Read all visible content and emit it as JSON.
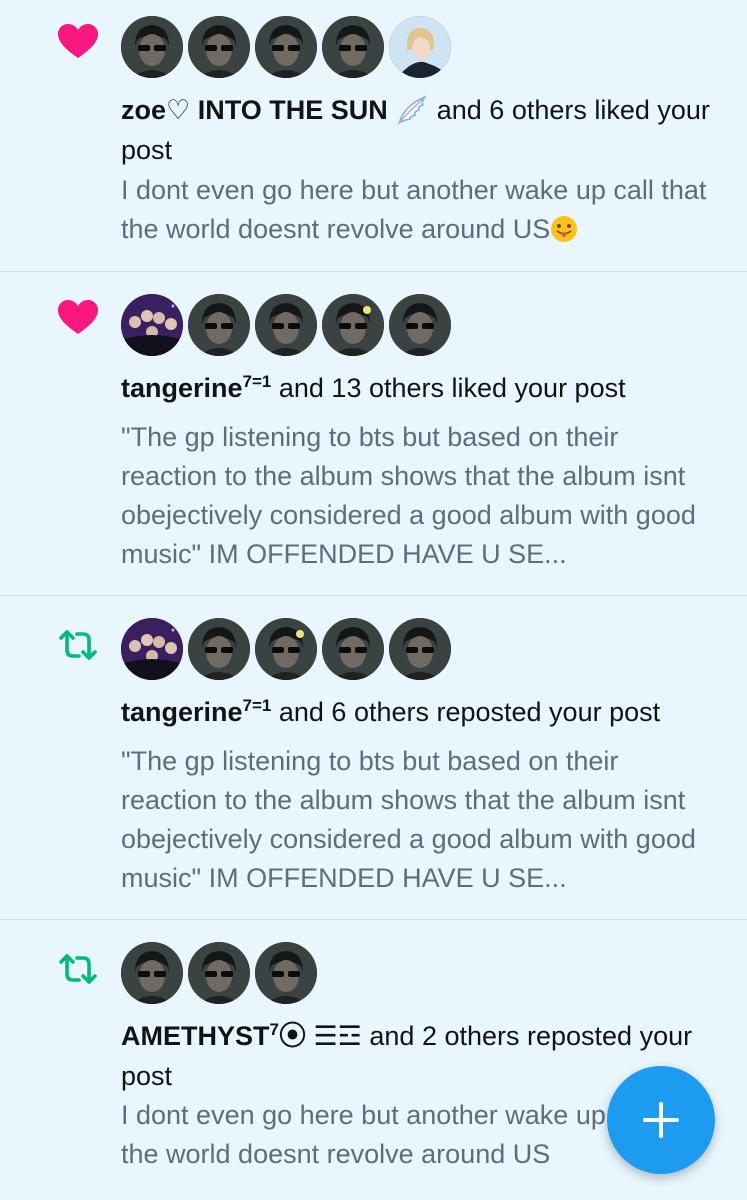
{
  "notifications": [
    {
      "type": "like",
      "icon": "heart-icon",
      "actor": "zoe♡ INTO THE SUN",
      "actor_emoji": "wing-emoji",
      "action": " and 6 others liked your post",
      "preview": "I dont even go here but another wake up call that the world doesnt revolve around US",
      "preview_emoji": "tongue-out-emoji"
    },
    {
      "type": "like",
      "icon": "heart-icon",
      "actor": "tangerine",
      "actor_sup": "7=1",
      "action": " and 13 others liked your post",
      "preview": "\"The gp listening to bts but based on their reaction to the album shows that the album isnt obejectively considered a good album with good music\" IM OFFENDED HAVE U SE..."
    },
    {
      "type": "repost",
      "icon": "repost-icon",
      "actor": "tangerine",
      "actor_sup": "7=1",
      "action": " and 6 others reposted your post",
      "preview": "\"The gp listening to bts but based on their reaction to the album shows that the album isnt obejectively considered a good album with good music\" IM OFFENDED HAVE U SE..."
    },
    {
      "type": "repost",
      "icon": "repost-icon",
      "actor": "AMETHYST",
      "actor_sup": "7",
      "actor_suffix": "⦿ ☰☲",
      "action": " and 2 others reposted your post",
      "preview": "I dont even go here but another wake up call that the world doesnt revolve around US"
    }
  ],
  "colors": {
    "background": "#e9f6fd",
    "like": "#f91880",
    "repost": "#00ba7c",
    "fab": "#1d9bf0",
    "preview_text": "#5f6d78"
  },
  "fab": {
    "icon": "plus-icon"
  }
}
